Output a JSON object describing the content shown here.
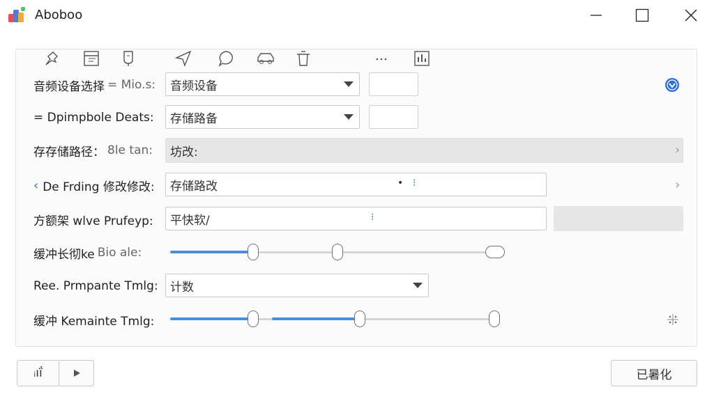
{
  "window": {
    "title": "Aboboo",
    "controls": {
      "minimize": "minimize-icon",
      "maximize": "maximize-icon",
      "close": "close-icon"
    }
  },
  "toolbar": {
    "icons": [
      "pin-icon",
      "calendar-icon",
      "cup-icon",
      "send-icon",
      "chat-icon",
      "car-icon",
      "trash-icon",
      "more-icon",
      "stats-icon"
    ]
  },
  "rows": {
    "audio_device": {
      "label": "音频设备选择",
      "suffix": "= Mio.s:",
      "value": "音频设备"
    },
    "deposit": {
      "label": "= Dpimpbole Deats:",
      "value": "存储路备"
    },
    "storage_path": {
      "label": "存存储路径：",
      "suffix": "8le tan:",
      "value": "坊改:"
    },
    "edit": {
      "label": "De Frding 修改修改:",
      "value": "存储路改"
    },
    "frame": {
      "label": "方额架 wlve Prufeyp:",
      "value": "平快软/"
    },
    "buffer": {
      "label": "缓冲长彻ke",
      "suffix": "Bio ale:"
    },
    "preset": {
      "label": "Ree. Prmpante Tmlg:",
      "value": "计数"
    },
    "buffer2": {
      "label": "缓冲 Kemainte Tmlg:"
    }
  },
  "sliders": {
    "buffer": {
      "fill": 0.25,
      "handles": [
        0.25,
        0.5,
        1.0
      ]
    },
    "buffer2": {
      "fill_a": 0.25,
      "fill_b": 0.58,
      "handles": [
        0.25,
        0.58,
        1.0
      ]
    }
  },
  "footer": {
    "left_button": "ᵢıḯ",
    "play_icon": "play-icon",
    "confirm_label": "已暑化"
  },
  "colors": {
    "accent": "#4a90d9",
    "info_icon": "#2f6fd0"
  }
}
